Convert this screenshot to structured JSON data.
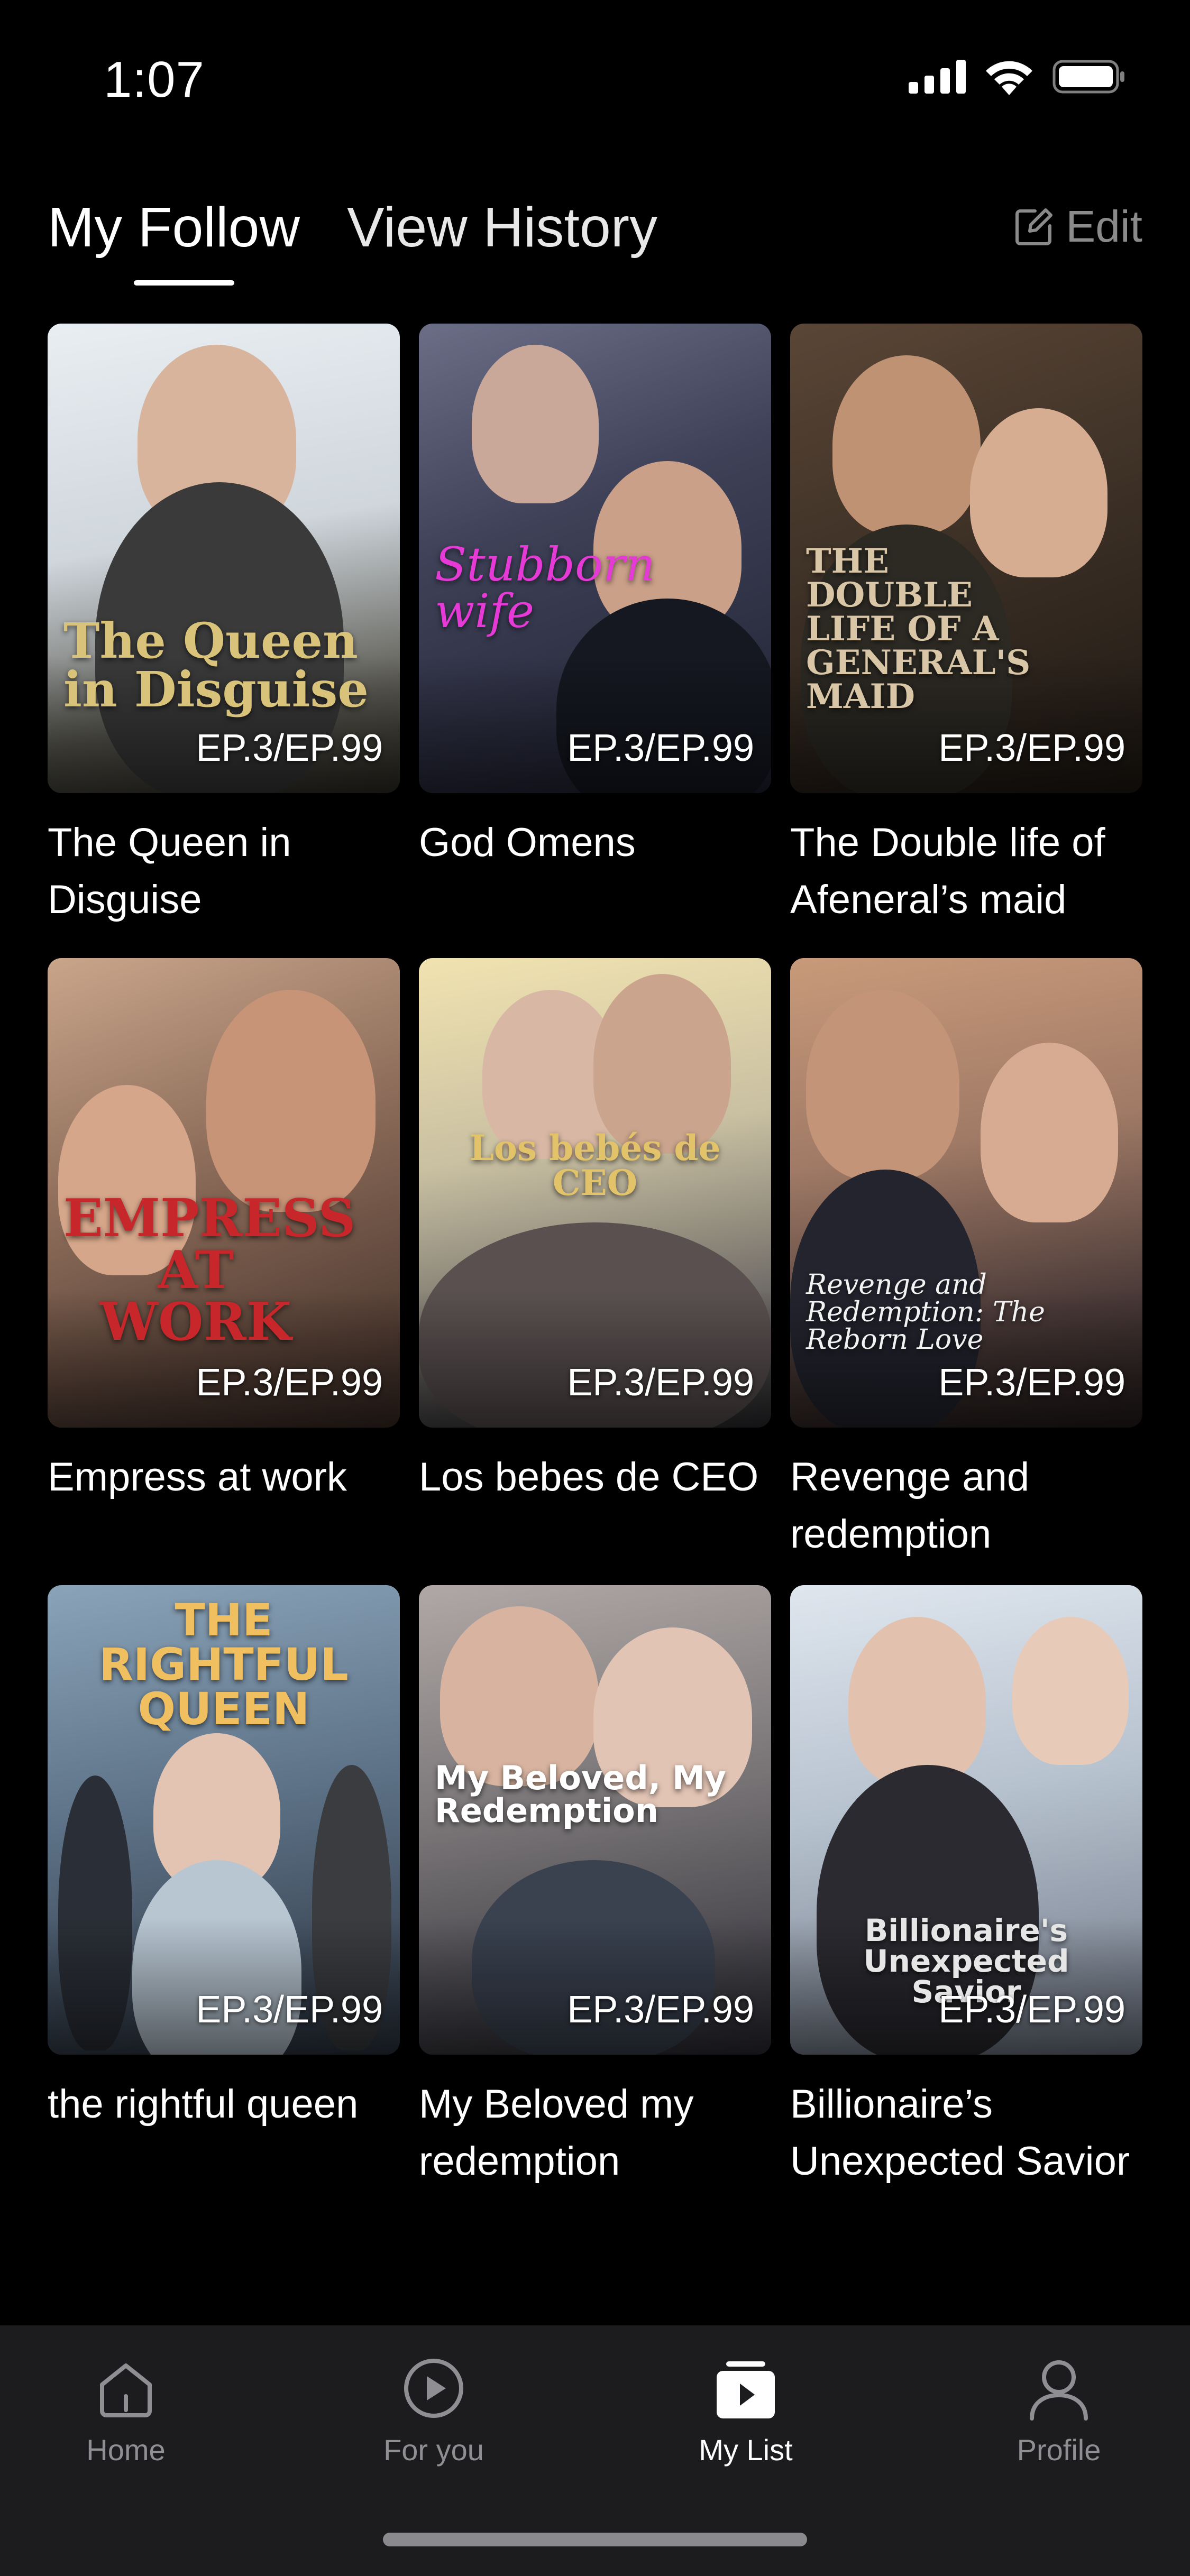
{
  "status": {
    "time": "1:07"
  },
  "tabs": {
    "follow": "My Follow",
    "history": "View History",
    "edit": "Edit"
  },
  "cards": [
    {
      "title": "The Queen in Disguise",
      "poster_text": "The Queen in Disguise",
      "ep": "EP.3/EP.99"
    },
    {
      "title": "God Omens",
      "poster_text": "Stubborn wife",
      "ep": "EP.3/EP.99"
    },
    {
      "title": "The Double life of Afeneral’s maid",
      "poster_text": "THE DOUBLE LIFE OF A GENERAL'S MAID",
      "ep": "EP.3/EP.99"
    },
    {
      "title": "Empress at work",
      "poster_text": "EMPRESS AT WORK",
      "ep": "EP.3/EP.99"
    },
    {
      "title": "Los bebes de CEO",
      "poster_text": "Los bebés de CEO",
      "ep": "EP.3/EP.99"
    },
    {
      "title": "Revenge and redemption",
      "poster_text": "Revenge and Redemption: The Reborn Love",
      "ep": "EP.3/EP.99"
    },
    {
      "title": "the rightful queen",
      "poster_text": "THE RIGHTFUL QUEEN",
      "ep": "EP.3/EP.99"
    },
    {
      "title": "My Beloved my redemption",
      "poster_text": "My Beloved, My Redemption",
      "ep": "EP.3/EP.99"
    },
    {
      "title": "Billionaire’s Unexpected Savior",
      "poster_text": "Billionaire's Unexpected Savior",
      "ep": "EP.3/EP.99"
    }
  ],
  "nav": {
    "home": "Home",
    "foryou": "For you",
    "mylist": "My List",
    "profile": "Profile"
  },
  "colors": {
    "background": "#000000",
    "nav_bg": "#1c1c1e",
    "inactive": "#8e8e93",
    "edit": "#8a8a8a"
  }
}
